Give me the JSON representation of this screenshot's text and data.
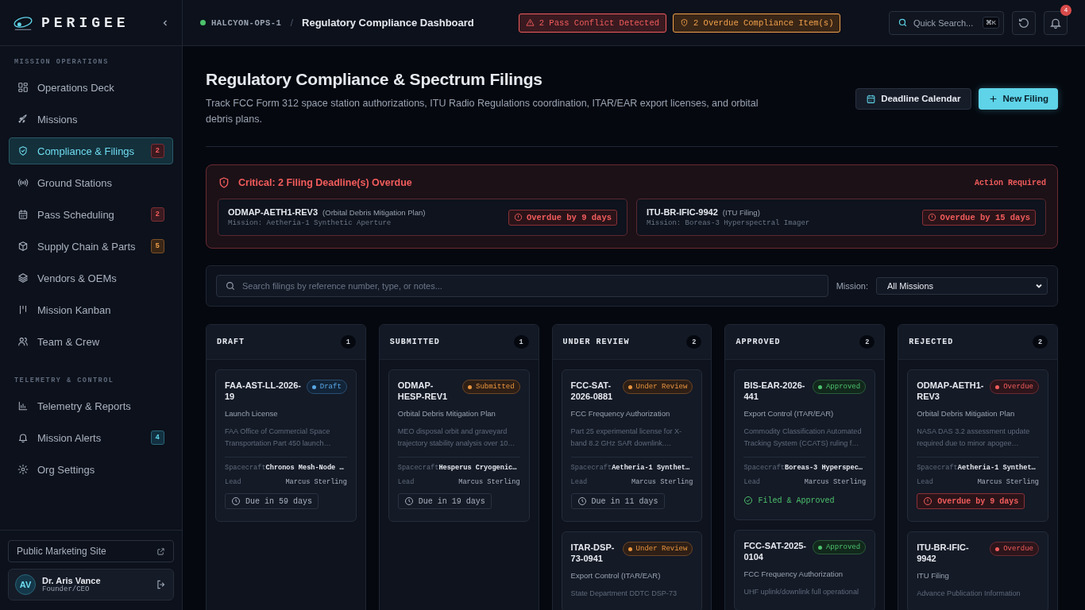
{
  "brand": {
    "name": "PERIGEE"
  },
  "sidebar": {
    "sections": [
      {
        "title": "MISSION OPERATIONS",
        "items": [
          {
            "label": "Operations Deck",
            "selected": false
          },
          {
            "label": "Missions",
            "selected": false
          },
          {
            "label": "Compliance & Filings",
            "selected": true,
            "badge": "2",
            "kind": "danger"
          },
          {
            "label": "Ground Stations",
            "selected": false
          },
          {
            "label": "Pass Scheduling",
            "selected": false,
            "badge": "2",
            "kind": "danger"
          },
          {
            "label": "Supply Chain & Parts",
            "selected": false,
            "badge": "5",
            "kind": "warning"
          },
          {
            "label": "Vendors & OEMs",
            "selected": false
          },
          {
            "label": "Mission Kanban",
            "selected": false
          },
          {
            "label": "Team & Crew",
            "selected": false
          }
        ]
      },
      {
        "title": "TELEMETRY & CONTROL",
        "items": [
          {
            "label": "Telemetry & Reports",
            "selected": false
          },
          {
            "label": "Mission Alerts",
            "selected": false,
            "badge": "4",
            "kind": "info"
          },
          {
            "label": "Org Settings",
            "selected": false
          }
        ]
      }
    ],
    "marketing_link": "Public Marketing Site",
    "user": {
      "initials": "AV",
      "name": "Dr. Aris Vance",
      "role": "Founder/CEO"
    }
  },
  "topbar": {
    "workspace": "HALCYON-OPS-1",
    "separator": "/",
    "page_title": "Regulatory Compliance Dashboard",
    "alerts": [
      {
        "kind": "danger",
        "text": "2 Pass Conflict Detected"
      },
      {
        "kind": "warning",
        "text": "2 Overdue Compliance Item(s)"
      }
    ],
    "search": {
      "placeholder": "Quick Search...",
      "shortcut": "⌘K"
    },
    "notifications": "4"
  },
  "header": {
    "title": "Regulatory Compliance & Spectrum Filings",
    "subtitle": "Track FCC Form 312 space station authorizations, ITU Radio Regulations coordination, ITAR/EAR export licenses, and orbital debris plans.",
    "buttons": [
      {
        "kind": "secondary",
        "label": "Deadline Calendar"
      },
      {
        "kind": "primary",
        "label": "New Filing"
      }
    ]
  },
  "overdue_alert": {
    "title": "Critical: 2 Filing Deadline(s) Overdue",
    "action": "Action Required",
    "items": [
      {
        "ref": "ODMAP-AETH1-REV3",
        "type": "(Orbital Debris Mitigation Plan)",
        "mission": "Mission: Aetheria-1 Synthetic Aperture",
        "overdue": "Overdue by 9 days"
      },
      {
        "ref": "ITU-BR-IFIC-9942",
        "type": "(ITU Filing)",
        "mission": "Mission: Boreas-3 Hyperspectral Imager",
        "overdue": "Overdue by 15 days"
      }
    ]
  },
  "filters": {
    "search_placeholder": "Search filings by reference number, type, or notes...",
    "mission_label": "Mission:",
    "mission_value": "All Missions"
  },
  "columns": [
    {
      "title": "DRAFT",
      "count": "1",
      "cards": [
        {
          "ref": "FAA-AST-LL-2026-19",
          "kind": "draft",
          "status_label": "Draft",
          "type": "Launch License",
          "desc": "FAA Office of Commercial Space Transportation Part 450 launch…",
          "spacecraft_label": "Spacecraft",
          "spacecraft": "Chronos Mesh-Node …",
          "lead_label": "Lead",
          "lead": "Marcus Sterling",
          "footer": {
            "kind": "due",
            "text": "Due in 59 days"
          }
        }
      ]
    },
    {
      "title": "SUBMITTED",
      "count": "1",
      "cards": [
        {
          "ref": "ODMAP-HESP-REV1",
          "kind": "submitted",
          "status_label": "Submitted",
          "type": "Orbital Debris Mitigation Plan",
          "desc": "MEO disposal orbit and graveyard trajectory stability analysis over 10…",
          "spacecraft_label": "Spacecraft",
          "spacecraft": "Hesperus Cryogenic…",
          "lead_label": "Lead",
          "lead": "Marcus Sterling",
          "footer": {
            "kind": "due",
            "text": "Due in 19 days"
          }
        }
      ]
    },
    {
      "title": "UNDER REVIEW",
      "count": "2",
      "cards": [
        {
          "ref": "FCC-SAT-2026-0881",
          "kind": "review",
          "status_label": "Under Review",
          "type": "FCC Frequency Authorization",
          "desc": "Part 25 experimental license for X-band 8.2 GHz SAR downlink.…",
          "spacecraft_label": "Spacecraft",
          "spacecraft": "Aetheria-1 Synthet…",
          "lead_label": "Lead",
          "lead": "Marcus Sterling",
          "footer": {
            "kind": "due",
            "text": "Due in 11 days"
          }
        },
        {
          "ref": "ITAR-DSP-73-0941",
          "kind": "review",
          "status_label": "Under Review",
          "type": "Export Control (ITAR/EAR)",
          "desc": "State Department DDTC DSP-73"
        }
      ]
    },
    {
      "title": "APPROVED",
      "count": "2",
      "cards": [
        {
          "ref": "BIS-EAR-2026-441",
          "kind": "approved",
          "status_label": "Approved",
          "type": "Export Control (ITAR/EAR)",
          "desc": "Commodity Classification Automated Tracking System (CCATS) ruling f…",
          "spacecraft_label": "Spacecraft",
          "spacecraft": "Boreas-3 Hyperspec…",
          "lead_label": "Lead",
          "lead": "Marcus Sterling",
          "footer": {
            "kind": "done",
            "text": "Filed & Approved"
          }
        },
        {
          "ref": "FCC-SAT-2025-0104",
          "kind": "approved",
          "status_label": "Approved",
          "type": "FCC Frequency Authorization",
          "desc": "UHF uplink/downlink full operational"
        }
      ]
    },
    {
      "title": "REJECTED",
      "count": "2",
      "cards": [
        {
          "ref": "ODMAP-AETH1-REV3",
          "kind": "overdue",
          "status_label": "Overdue",
          "type": "Orbital Debris Mitigation Plan",
          "desc": "NASA DAS 3.2 assessment update required due to minor apogee…",
          "spacecraft_label": "Spacecraft",
          "spacecraft": "Aetheria-1 Synthet…",
          "lead_label": "Lead",
          "lead": "Marcus Sterling",
          "footer": {
            "kind": "overdue",
            "text": "Overdue by 9 days"
          }
        },
        {
          "ref": "ITU-BR-IFIC-9942",
          "kind": "overdue",
          "status_label": "Overdue",
          "type": "ITU Filing",
          "desc": "Advance Publication Information"
        }
      ]
    }
  ]
}
